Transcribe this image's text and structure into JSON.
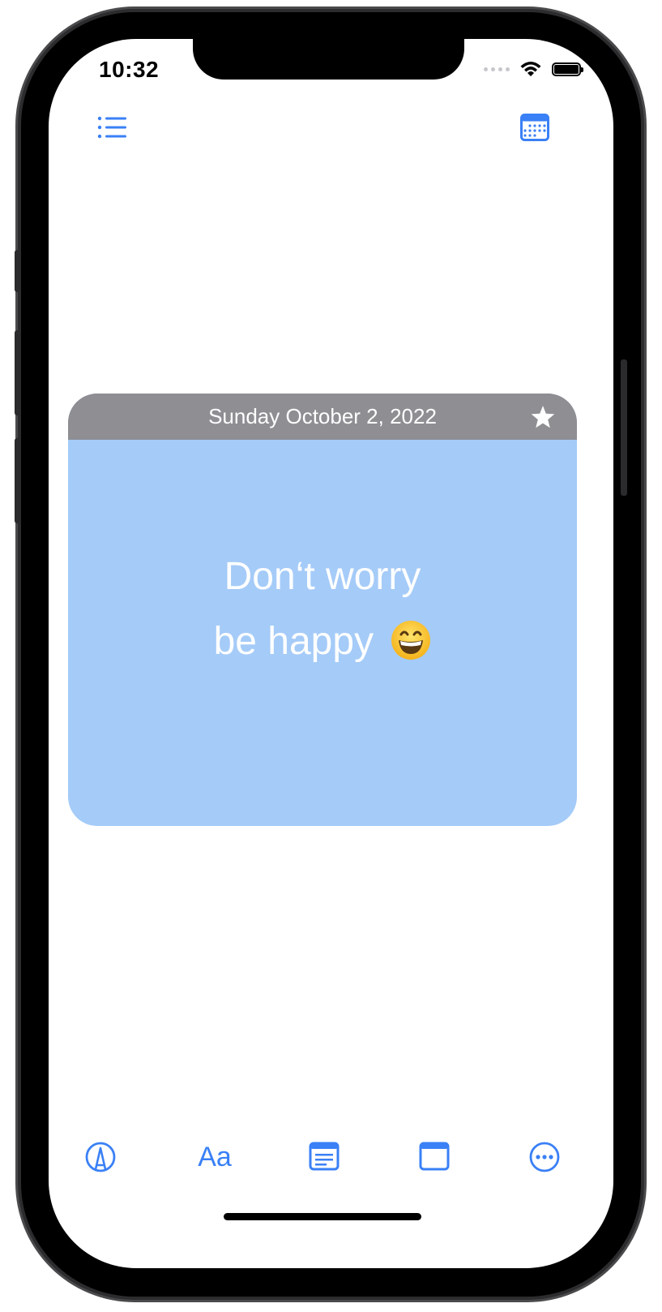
{
  "status_bar": {
    "time": "10:32"
  },
  "card": {
    "date": "Sunday October 2, 2022",
    "header_color": "#8e8e93",
    "background_color": "#a5cbf8",
    "line1": "Don‘t worry",
    "line2": "be happy",
    "emoji": "grinning-face"
  },
  "toolbar": {
    "text_label": "Aa"
  },
  "colors": {
    "accent": "#3a80f6"
  },
  "icons": [
    "list-icon",
    "calendar-icon",
    "star-icon",
    "markup-icon",
    "note-icon",
    "window-icon",
    "more-icon"
  ]
}
